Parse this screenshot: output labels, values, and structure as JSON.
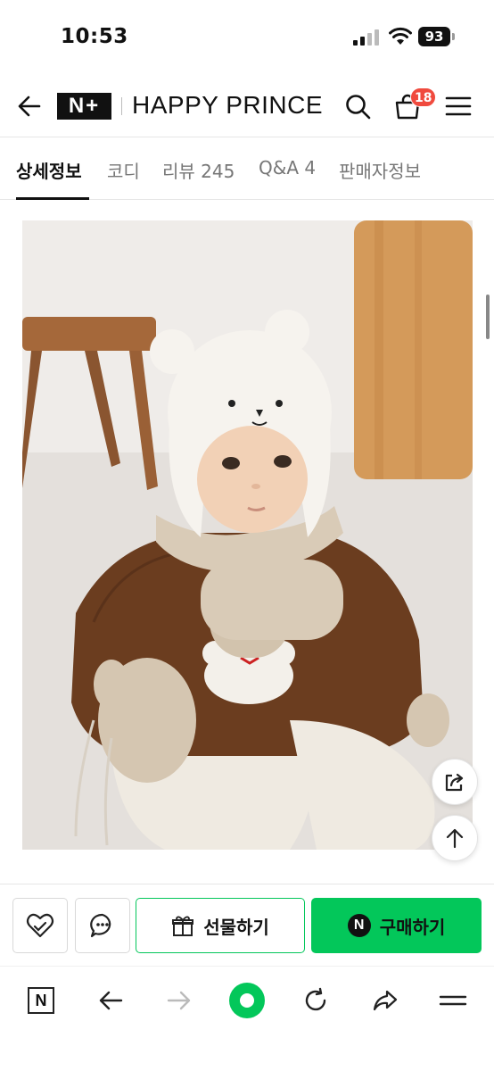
{
  "status_bar": {
    "time": "10:53",
    "battery": "93"
  },
  "header": {
    "brand_logo": "N+",
    "brand_name": "HAPPY PRINCE",
    "cart_count": "18"
  },
  "tabs": [
    {
      "label": "상세정보",
      "active": true
    },
    {
      "label": "코디",
      "active": false
    },
    {
      "label": "리뷰 245",
      "active": false
    },
    {
      "label": "Q&A 4",
      "active": false
    },
    {
      "label": "판매자정보",
      "active": false
    }
  ],
  "purchase_bar": {
    "gift_label": "선물하기",
    "buy_label": "구매하기",
    "buy_logo": "N"
  },
  "toolbar": {
    "home_label": "N"
  },
  "colors": {
    "accent": "#03c75a",
    "badge": "#f04a3e"
  },
  "icons": [
    "back-icon",
    "search-icon",
    "cart-icon",
    "menu-icon",
    "heart-icon",
    "chat-icon",
    "gift-icon",
    "share-icon",
    "arrow-up-icon",
    "reload-icon",
    "forward-icon"
  ]
}
